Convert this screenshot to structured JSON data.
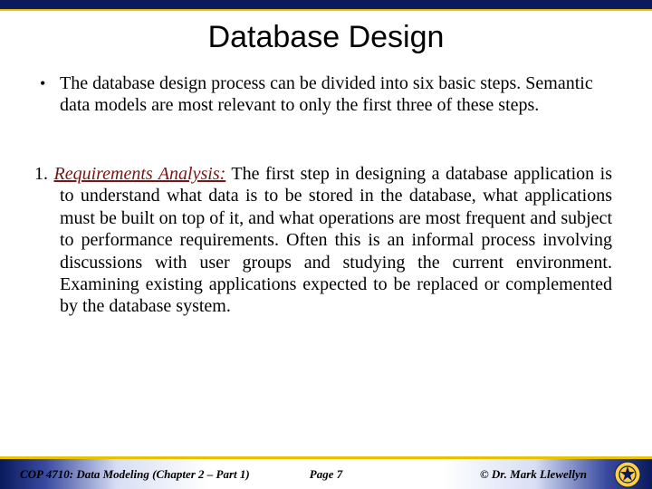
{
  "title": "Database Design",
  "bullet": {
    "dot": "•",
    "text": "The database design process can be divided into six basic steps.  Semantic data models are most relevant to only the first three of these steps."
  },
  "numbered": {
    "prefix": "1. ",
    "label": "Requirements Analysis:",
    "body": " The first step in designing a database application is to understand what data is to be stored in the database, what applications must be built on top of it, and what operations are most frequent and subject to performance requirements.  Often this is an informal process involving discussions with user groups and studying the current environment.  Examining existing applications expected to be replaced or complemented by the database system."
  },
  "footer": {
    "left": "COP 4710: Data Modeling (Chapter 2 – Part 1)",
    "center": "Page 7",
    "right": "© Dr. Mark Llewellyn"
  }
}
